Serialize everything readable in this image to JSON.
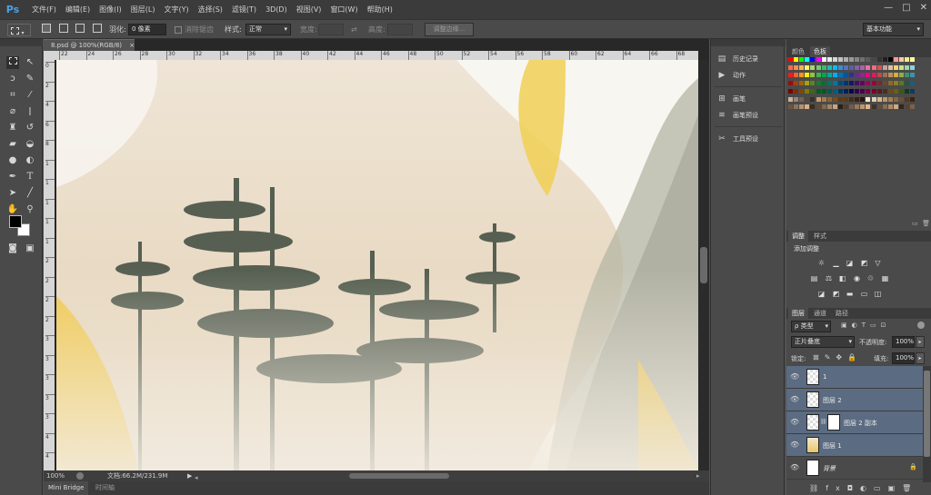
{
  "app": {
    "logo": "Ps",
    "title_controls": [
      "—",
      "□",
      "✕"
    ]
  },
  "menu": [
    "文件(F)",
    "编辑(E)",
    "图像(I)",
    "图层(L)",
    "文字(Y)",
    "选择(S)",
    "滤镜(T)",
    "3D(D)",
    "视图(V)",
    "窗口(W)",
    "帮助(H)"
  ],
  "options": {
    "feather_label": "羽化:",
    "feather_value": "0 像素",
    "antialias_label": "消除锯齿",
    "style_label": "样式:",
    "style_value": "正常",
    "width_label": "宽度:",
    "height_label": "高度:",
    "refine_edge": "调整边缘...",
    "workspace": "基本功能"
  },
  "document": {
    "tab_title": "8.psd @ 100%(RGB/8)",
    "close": "×"
  },
  "ruler_h": [
    "22",
    "24",
    "26",
    "28",
    "30",
    "32",
    "34",
    "36",
    "38",
    "40",
    "42",
    "44",
    "46",
    "48",
    "50",
    "52",
    "54",
    "56",
    "58",
    "60",
    "62",
    "64",
    "66",
    "68",
    "70"
  ],
  "ruler_v": [
    "0",
    "2",
    "4",
    "6",
    "8",
    "1",
    "1",
    "1",
    "1",
    "1",
    "2",
    "2",
    "2",
    "2",
    "3",
    "3",
    "3",
    "3",
    "3",
    "4",
    "4"
  ],
  "status": {
    "zoom": "100%",
    "doc_info": "文档:66.2M/231.9M"
  },
  "bottom_tabs": [
    "Mini Bridge",
    "时间轴"
  ],
  "mid_panel": [
    {
      "icon": "history-icon",
      "label": "历史记录"
    },
    {
      "icon": "play-icon",
      "label": "动作"
    },
    {
      "icon": "brush-icon",
      "label": "画笔"
    },
    {
      "icon": "brush-presets-icon",
      "label": "画笔预设"
    },
    {
      "icon": "tool-presets-icon",
      "label": "工具预设"
    }
  ],
  "color_panel": {
    "tabs": [
      "颜色",
      "色板"
    ]
  },
  "adjust_panel": {
    "tabs": [
      "调整",
      "样式"
    ],
    "title": "添加调整"
  },
  "layers_panel": {
    "tabs": [
      "图层",
      "通道",
      "路径"
    ],
    "kind_label": "ρ 类型",
    "blend_mode": "正片叠底",
    "opacity_label": "不透明度:",
    "opacity_value": "100%",
    "lock_label": "锁定:",
    "fill_label": "填充:",
    "fill_value": "100%",
    "layers": [
      {
        "name": "1",
        "selected": true
      },
      {
        "name": "图层 2",
        "selected": true
      },
      {
        "name": "图层 2 副本",
        "selected": true
      },
      {
        "name": "图层 1",
        "selected": true
      },
      {
        "name": "背景",
        "selected": false
      }
    ]
  },
  "colors": {
    "accent": "#4aa2e8",
    "layer_selected": "#5b6b81",
    "panel": "#4a4a4a"
  }
}
